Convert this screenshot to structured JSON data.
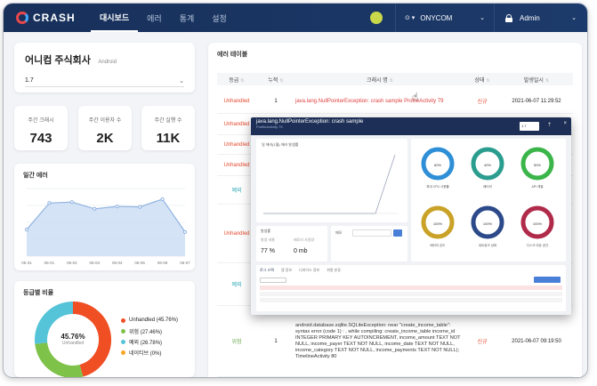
{
  "app": {
    "logo_text": "CRASH",
    "nav_tabs": [
      "대시보드",
      "에러",
      "통계",
      "설정"
    ],
    "active_tab": 0,
    "project": "ONYCOM",
    "project_icon": "circle-dot-icon",
    "user": "Admin",
    "avatar_color": "#c8d84a",
    "accent": "#1c3a6b"
  },
  "company": {
    "name": "어니컴 주식회사",
    "os": "Android",
    "version": "1.7"
  },
  "stats": [
    {
      "label": "주간 크래시",
      "value": "743"
    },
    {
      "label": "주간 이용자 수",
      "value": "2K"
    },
    {
      "label": "주간 실행 수",
      "value": "11K"
    }
  ],
  "daily": {
    "title": "일간 에러",
    "chart_data": {
      "type": "area",
      "categories": [
        "05-31",
        "06-01",
        "06-02",
        "06-03",
        "06-04",
        "06-05",
        "06-06",
        "06-07"
      ],
      "values": [
        55,
        110,
        112,
        98,
        103,
        102,
        118,
        50
      ],
      "ylim": [
        0,
        140
      ],
      "grid": true,
      "color": "#8fb3e0"
    }
  },
  "grade": {
    "title": "등급별 비율",
    "center_pct": "45.76%",
    "center_label": "Unhandled",
    "chart_data": {
      "type": "pie",
      "labels": [
        "Unhandled (45.76%)",
        "위험 (27.46%)",
        "예외 (26.78%)",
        "네이티브 (0%)"
      ],
      "values": [
        45.76,
        27.46,
        26.78,
        0
      ],
      "colors": [
        "#f04e23",
        "#7fc24a",
        "#55c3d8",
        "#f5a623"
      ]
    }
  },
  "table": {
    "title": "에러 테이블",
    "headers": [
      "등급",
      "누적",
      "크래시 명",
      "상태",
      "발생일시"
    ],
    "rows": [
      {
        "grade": "Unhandled",
        "count": "1",
        "name": "java.lang.NullPointerException: crash sample ProfileActivity 79",
        "status": "신규",
        "date": "2021-06-07 11:29:52"
      },
      {
        "grade": "Unhandled",
        "count": "",
        "name": "",
        "status": "",
        "date": ""
      },
      {
        "grade": "Unhandled",
        "count": "",
        "name": "",
        "status": "",
        "date": ""
      },
      {
        "grade": "Unhandled",
        "count": "",
        "name": "",
        "status": "",
        "date": ""
      },
      {
        "grade": "예외",
        "count": "",
        "name": "",
        "status": "",
        "date": ""
      },
      {
        "grade": "Unhandled",
        "count": "",
        "name": "",
        "status": "",
        "date": ""
      },
      {
        "grade": "예외",
        "count": "",
        "name": "",
        "status": "",
        "date": ""
      },
      {
        "grade": "위험",
        "count": "1",
        "name": "android.database.sqlite.SQLiteException: near \"create_income_table\": syntax error (code 1) : , while compiling: create_income_table income_id INTEGER PRIMARY KEY AUTOINCREMENT, income_amount TEXT NOT NULL, income_payer TEXT NOT NULL, income_date TEXT NOT NULL, income_category TEXT NOT NULL, income_payments TEXT NOT NULL); TimelineActivity 80",
        "status": "신규",
        "date": "2021-06-07 09:19:50"
      }
    ]
  },
  "popup": {
    "title": "java.lang.NullPointerException: crash sample",
    "subtitle": "ProfileActivity 79",
    "select_value": "1.7",
    "close": "×",
    "chart_title": "일 에러(1월) 에러 발생률",
    "rate_title": "발생률",
    "rate_col1": "발생 비율",
    "rate_col2": "메모리 사용량",
    "rate_val1": "77 %",
    "rate_val2": "0 mb",
    "memo_title": "메모",
    "tabs": [
      "로그 스택",
      "앱 정보",
      "디바이스 정보",
      "위험 분류"
    ],
    "rings": [
      {
        "name": "최대 CPU 사용률",
        "color": "#2f8fd6"
      },
      {
        "name": "배터리",
        "color": "#2a9d8f"
      },
      {
        "name": "API 레벨",
        "color": "#3bb54a"
      },
      {
        "name": "배터리 온도",
        "color": "#c9a227"
      },
      {
        "name": "네트워크 상태",
        "color": "#2c4a8a"
      },
      {
        "name": "디스크 여유 공간",
        "color": "#b02a4a"
      }
    ],
    "ring_values": [
      "60%",
      "40%",
      "50%",
      "100%",
      "100%",
      "100%"
    ]
  }
}
